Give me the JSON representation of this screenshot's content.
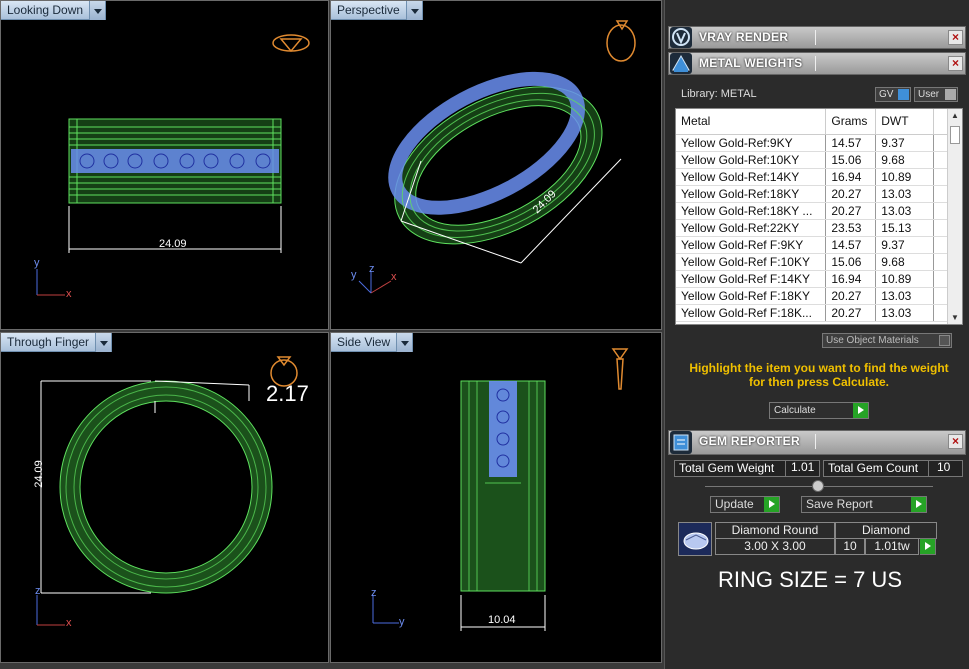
{
  "viewports": {
    "top_left": {
      "title": "Looking Down",
      "dim": "24.09",
      "axis_a": "y",
      "axis_b": "x"
    },
    "top_right": {
      "title": "Perspective",
      "dim": "24.09",
      "axis_a": "z",
      "axis_b": "y",
      "axis_c": "x"
    },
    "bottom_left": {
      "title": "Through Finger",
      "dim_vertical": "24.09",
      "dim_thickness": "2.17",
      "axis_a": "z",
      "axis_b": "x"
    },
    "bottom_right": {
      "title": "Side View",
      "dim": "10.04",
      "axis_a": "z",
      "axis_b": "y"
    }
  },
  "panel": {
    "vray": {
      "title": "VRAY RENDER",
      "close": "×"
    },
    "metal": {
      "title": "METAL WEIGHTS",
      "close": "×",
      "library_label": "Library: METAL",
      "gv_label": "GV",
      "user_label": "User",
      "columns": [
        "Metal",
        "Grams",
        "DWT"
      ],
      "rows": [
        [
          "Yellow Gold-Ref:9KY",
          "14.57",
          "9.37"
        ],
        [
          "Yellow Gold-Ref:10KY",
          "15.06",
          "9.68"
        ],
        [
          "Yellow Gold-Ref:14KY",
          "16.94",
          "10.89"
        ],
        [
          "Yellow Gold-Ref:18KY",
          "20.27",
          "13.03"
        ],
        [
          "Yellow Gold-Ref:18KY ...",
          "20.27",
          "13.03"
        ],
        [
          "Yellow Gold-Ref:22KY",
          "23.53",
          "15.13"
        ],
        [
          "Yellow Gold-Ref F:9KY",
          "14.57",
          "9.37"
        ],
        [
          "Yellow Gold-Ref F:10KY",
          "15.06",
          "9.68"
        ],
        [
          "Yellow Gold-Ref F:14KY",
          "16.94",
          "10.89"
        ],
        [
          "Yellow Gold-Ref F:18KY",
          "20.27",
          "13.03"
        ],
        [
          "Yellow Gold-Ref F:18K...",
          "20.27",
          "13.03"
        ]
      ],
      "use_object_materials": "Use Object Materials",
      "hint": "Highlight the item you want to find the weight for then press Calculate.",
      "calculate": "Calculate"
    },
    "gem": {
      "title": "GEM REPORTER",
      "close": "×",
      "total_weight_label": "Total Gem Weight",
      "total_weight_value": "1.01",
      "total_count_label": "Total Gem Count",
      "total_count_value": "10",
      "update": "Update",
      "save_report": "Save Report",
      "gem_name": "Diamond Round",
      "gem_size": "3.00 X 3.00",
      "gem_type": "Diamond",
      "gem_count": "10",
      "gem_weight": "1.01tw"
    },
    "ring_size": "RING SIZE = 7 US"
  },
  "colors": {
    "wire": "#5ee05e",
    "gem": "#6a8ef0",
    "hint": "#f0c000"
  }
}
